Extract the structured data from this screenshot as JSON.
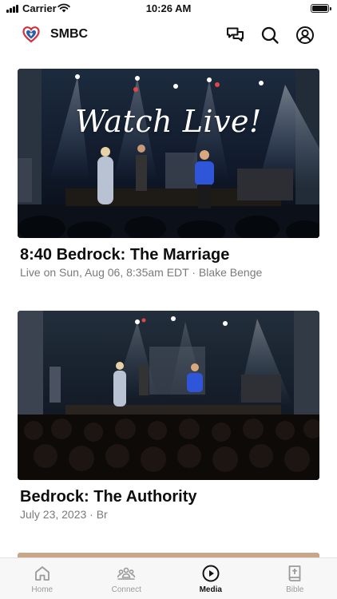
{
  "status_bar": {
    "carrier": "Carrier",
    "time": "10:26 AM"
  },
  "header": {
    "title": "SMBC",
    "icons": [
      "chat-icon",
      "search-icon",
      "account-icon"
    ]
  },
  "media": [
    {
      "overlay_text": "Watch Live!",
      "title": "8:40 Bedrock: The Marriage",
      "subtitle": "Live on Sun, Aug 06, 8:35am EDT · Blake Benge"
    },
    {
      "title": "Bedrock: The Authority",
      "subtitle": "July 23, 2023 · Br"
    }
  ],
  "tabs": [
    {
      "label": "Home",
      "icon": "home-icon",
      "active": false
    },
    {
      "label": "Connect",
      "icon": "people-icon",
      "active": false
    },
    {
      "label": "Media",
      "icon": "play-icon",
      "active": true
    },
    {
      "label": "Bible",
      "icon": "bible-icon",
      "active": false
    }
  ],
  "colors": {
    "accent": "#111111",
    "inactive": "#9a9a9a",
    "logo_red": "#d2323c",
    "logo_blue": "#2a5ea8"
  }
}
